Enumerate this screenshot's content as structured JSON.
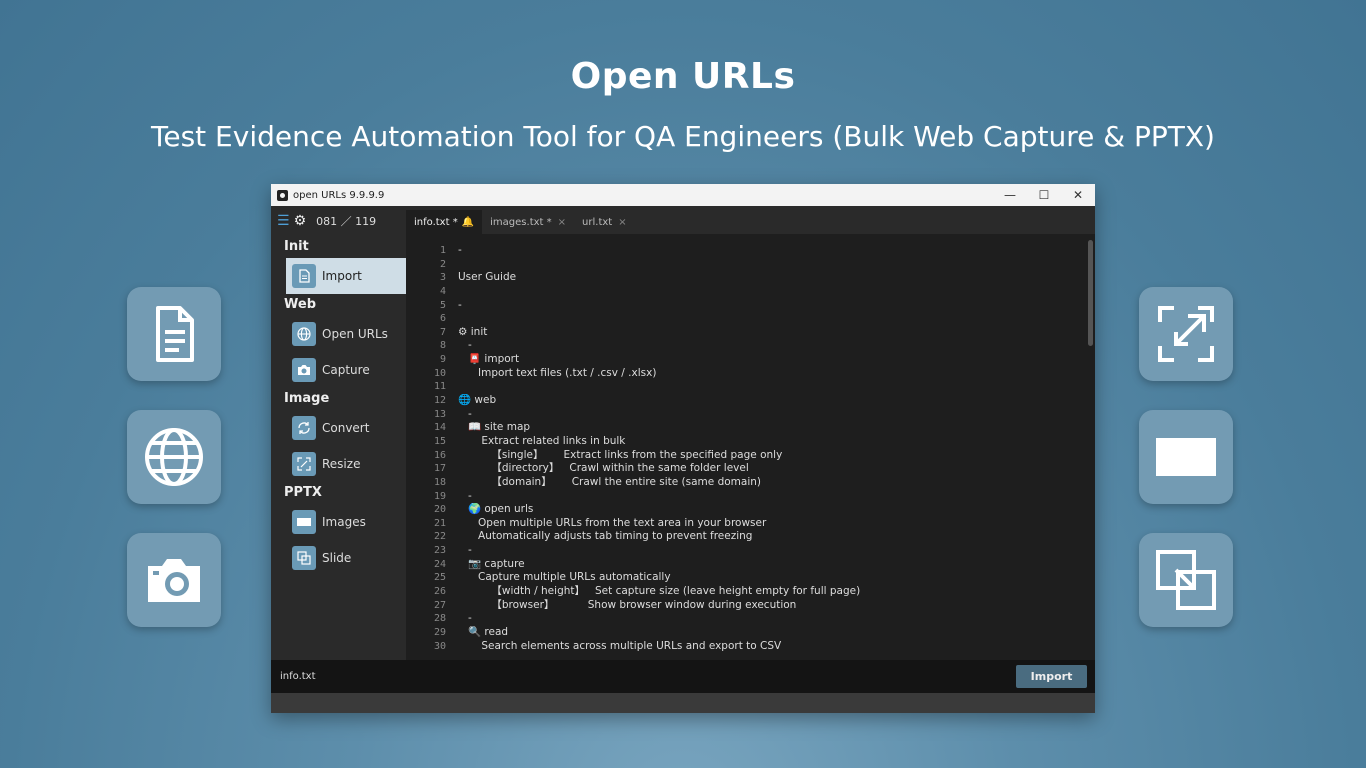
{
  "hero": {
    "title": "Open URLs",
    "subtitle": "Test Evidence Automation Tool for QA Engineers (Bulk Web Capture & PPTX)"
  },
  "tiles_left": [
    "document-icon",
    "globe-icon",
    "camera-icon"
  ],
  "tiles_right": [
    "resize-icon",
    "image-icon",
    "slide-icon"
  ],
  "window": {
    "title": "open URLs 9.9.9.9",
    "controls": {
      "minimize": "—",
      "maximize": "☐",
      "close": "✕"
    }
  },
  "sidebar": {
    "counter": "081 ／ 119",
    "sections": [
      {
        "label": "Init",
        "items": [
          {
            "label": "Import",
            "icon": "document-icon",
            "active": true
          }
        ]
      },
      {
        "label": "Web",
        "items": [
          {
            "label": "Open URLs",
            "icon": "globe-icon"
          },
          {
            "label": "Capture",
            "icon": "camera-icon"
          }
        ]
      },
      {
        "label": "Image",
        "items": [
          {
            "label": "Convert",
            "icon": "convert-icon"
          },
          {
            "label": "Resize",
            "icon": "resize-icon"
          }
        ]
      },
      {
        "label": "PPTX",
        "items": [
          {
            "label": "Images",
            "icon": "image-icon"
          },
          {
            "label": "Slide",
            "icon": "slide-icon"
          }
        ]
      }
    ]
  },
  "tabs": [
    {
      "label": "info.txt *",
      "active": true,
      "badge": "🔔"
    },
    {
      "label": "images.txt *",
      "close": "×"
    },
    {
      "label": "url.txt",
      "close": "×"
    }
  ],
  "editor": {
    "line_numbers": [
      "1",
      "2",
      "3",
      "4",
      "5",
      "6",
      "7",
      "8",
      "9",
      "10",
      "11",
      "12",
      "13",
      "14",
      "15",
      "16",
      "17",
      "18",
      "19",
      "20",
      "21",
      "22",
      "23",
      "24",
      "25",
      "26",
      "27",
      "28",
      "29",
      "30"
    ],
    "lines": [
      "-",
      "",
      "User Guide",
      "",
      "-",
      "",
      "⚙ init",
      "   -",
      "   📮 import",
      "      Import text files (.txt / .csv / .xlsx)",
      "",
      "🌐 web",
      "   -",
      "   📖 site map",
      "       Extract related links in bulk",
      "          【single】      Extract links from the specified page only",
      "          【directory】   Crawl within the same folder level",
      "          【domain】      Crawl the entire site (same domain)",
      "   -",
      "   🌍 open urls",
      "      Open multiple URLs from the text area in your browser",
      "      Automatically adjusts tab timing to prevent freezing",
      "   -",
      "   📷 capture",
      "      Capture multiple URLs automatically",
      "          【width / height】   Set capture size (leave height empty for full page)",
      "          【browser】          Show browser window during execution",
      "   -",
      "   🔍 read",
      "       Search elements across multiple URLs and export to CSV"
    ]
  },
  "status": {
    "file": "info.txt",
    "action_button": "Import"
  }
}
